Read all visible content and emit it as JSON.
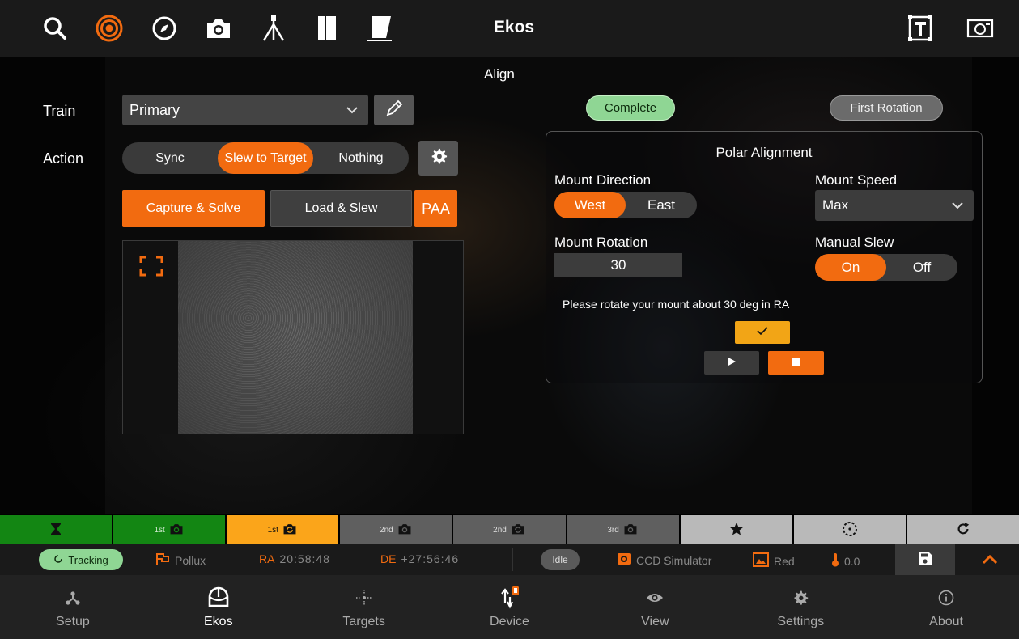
{
  "header": {
    "title": "Ekos",
    "icons": [
      "search-icon",
      "target-icon",
      "compass-icon",
      "camera-icon",
      "tripod-icon",
      "filter-icon",
      "dome-icon",
      "text-overlay-icon",
      "frame-icon"
    ]
  },
  "align": {
    "title": "Align",
    "train_label": "Train",
    "train_value": "Primary",
    "action_label": "Action",
    "actions": [
      "Sync",
      "Slew to Target",
      "Nothing"
    ],
    "selected_action": "Slew to Target",
    "capture_solve": "Capture & Solve",
    "load_slew": "Load & Slew",
    "paa": "PAA"
  },
  "polar": {
    "status_complete": "Complete",
    "status_first_rotation": "First Rotation",
    "title": "Polar Alignment",
    "mount_direction_label": "Mount Direction",
    "direction_west": "West",
    "direction_east": "East",
    "selected_direction": "West",
    "mount_speed_label": "Mount Speed",
    "mount_speed_value": "Max",
    "mount_rotation_label": "Mount Rotation",
    "mount_rotation_value": "30",
    "manual_slew_label": "Manual Slew",
    "manual_on": "On",
    "manual_off": "Off",
    "manual_selected": "On",
    "message": "Please rotate your mount about 30 deg in RA"
  },
  "stages": [
    {
      "label": "",
      "icon": "hourglass-icon",
      "state": "done"
    },
    {
      "label": "1st",
      "icon": "camera-icon",
      "state": "done"
    },
    {
      "label": "1st",
      "icon": "camera-rotate-icon",
      "state": "active"
    },
    {
      "label": "2nd",
      "icon": "camera-icon",
      "state": "pending"
    },
    {
      "label": "2nd",
      "icon": "camera-rotate-icon",
      "state": "pending"
    },
    {
      "label": "3rd",
      "icon": "camera-icon",
      "state": "pending"
    },
    {
      "label": "",
      "icon": "star-icon",
      "state": "light"
    },
    {
      "label": "",
      "icon": "circle-dashed-icon",
      "state": "dark"
    },
    {
      "label": "",
      "icon": "refresh-icon",
      "state": "light"
    }
  ],
  "status": {
    "tracking": "Tracking",
    "target": "Pollux",
    "ra_label": "RA",
    "ra_value": "20:58:48",
    "de_label": "DE",
    "de_value": "+27:56:46",
    "state": "Idle",
    "camera": "CCD Simulator",
    "filter": "Red",
    "temperature": "0.0"
  },
  "nav": [
    {
      "label": "Setup",
      "icon": "setup-icon"
    },
    {
      "label": "Ekos",
      "icon": "ekos-icon"
    },
    {
      "label": "Targets",
      "icon": "targets-icon"
    },
    {
      "label": "Device",
      "icon": "device-icon"
    },
    {
      "label": "View",
      "icon": "eye-icon"
    },
    {
      "label": "Settings",
      "icon": "gear-icon"
    },
    {
      "label": "About",
      "icon": "info-icon"
    }
  ],
  "colors": {
    "accent": "#f26b10",
    "complete": "#8fd694",
    "stage_done": "#138613",
    "stage_active": "#fba51a"
  }
}
